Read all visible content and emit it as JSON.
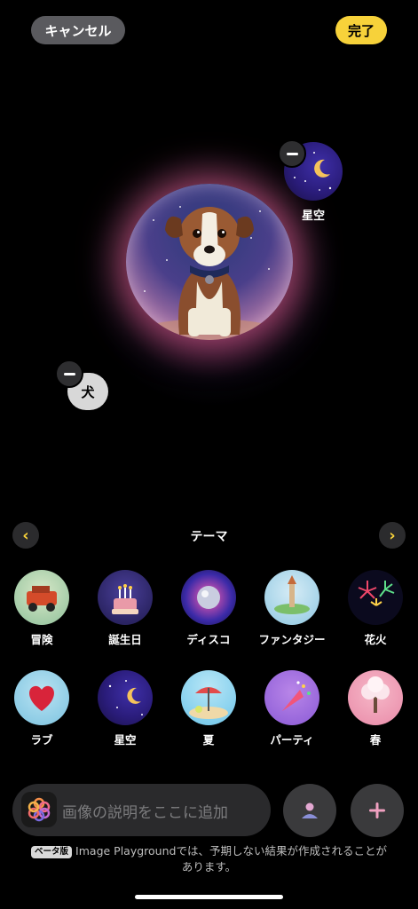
{
  "header": {
    "cancel_label": "キャンセル",
    "done_label": "完了"
  },
  "canvas": {
    "chips": [
      {
        "label": "星空",
        "icon": "starry-sky-thumbnail"
      },
      {
        "label": "犬"
      }
    ],
    "main_image": "dog-with-collar-starry-background"
  },
  "themes": {
    "title": "テーマ",
    "items": [
      {
        "label": "冒険",
        "icon": "red-jeep-icon"
      },
      {
        "label": "誕生日",
        "icon": "birthday-cake-icon"
      },
      {
        "label": "ディスコ",
        "icon": "disco-ball-icon"
      },
      {
        "label": "ファンタジー",
        "icon": "fantasy-castle-icon"
      },
      {
        "label": "花火",
        "icon": "fireworks-icon"
      },
      {
        "label": "ラブ",
        "icon": "heart-balloon-icon"
      },
      {
        "label": "星空",
        "icon": "starry-sky-icon"
      },
      {
        "label": "夏",
        "icon": "beach-umbrella-icon"
      },
      {
        "label": "パーティ",
        "icon": "party-horn-icon"
      },
      {
        "label": "春",
        "icon": "blossom-tree-icon"
      }
    ]
  },
  "composer": {
    "placeholder": "画像の説明をここに追加",
    "person_icon": "person-icon",
    "add_icon": "plus-icon"
  },
  "footer": {
    "beta_badge": "ベータ版",
    "notice": "Image Playgroundでは、予期しない結果が作成されることがあります。"
  },
  "colors": {
    "accent": "#f7d23a",
    "background": "#000000"
  }
}
